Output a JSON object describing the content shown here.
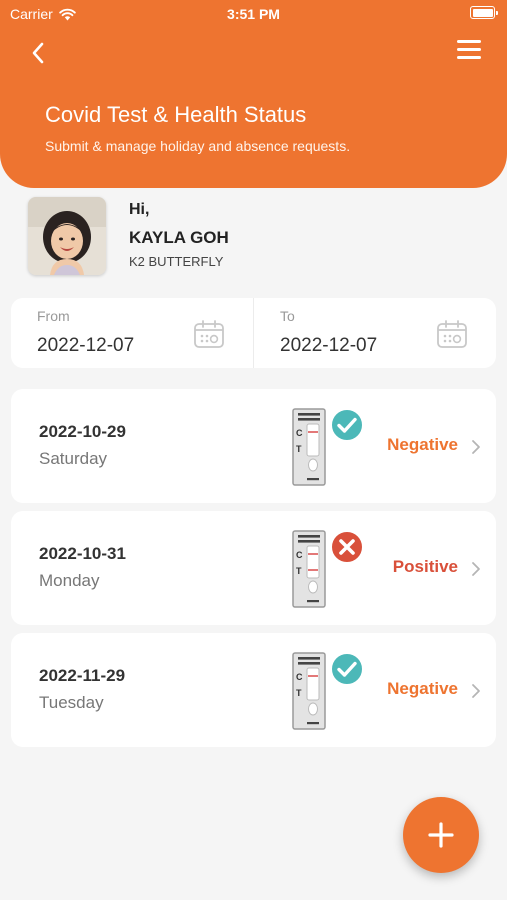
{
  "status_bar": {
    "carrier": "Carrier",
    "time": "3:51 PM"
  },
  "header": {
    "title": "Covid Test & Health Status",
    "subtitle": "Submit & manage holiday and absence requests."
  },
  "profile": {
    "greeting": "Hi,",
    "name": "KAYLA GOH",
    "class": "K2 BUTTERFLY"
  },
  "date_range": {
    "from_label": "From",
    "from_value": "2022-12-07",
    "to_label": "To",
    "to_value": "2022-12-07"
  },
  "kit_labels": {
    "c": "C",
    "t": "T"
  },
  "records": [
    {
      "date": "2022-10-29",
      "day": "Saturday",
      "result": "Negative"
    },
    {
      "date": "2022-10-31",
      "day": "Monday",
      "result": "Positive"
    },
    {
      "date": "2022-11-29",
      "day": "Tuesday",
      "result": "Negative"
    }
  ],
  "colors": {
    "accent": "#ee7430",
    "negative": "#ee7430",
    "positive": "#d9503a",
    "check_badge": "#4cb8b8",
    "cross_badge": "#d9503a"
  },
  "icons": [
    "back-chevron-icon",
    "hamburger-menu-icon",
    "calendar-icon",
    "test-kit-icon",
    "check-badge-icon",
    "cross-badge-icon",
    "chevron-right-icon",
    "plus-icon",
    "wifi-icon",
    "battery-icon"
  ]
}
